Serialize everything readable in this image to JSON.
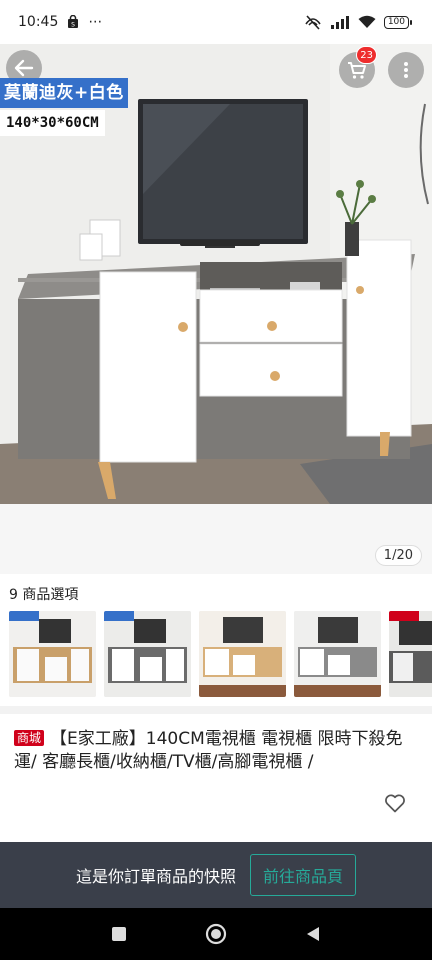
{
  "status_bar": {
    "time": "10:45",
    "more_indicator": "⋯",
    "battery": "100"
  },
  "product_image": {
    "color_tag": "莫蘭迪灰+白色",
    "size_tag": "140*30*60CM",
    "page_counter": "1/20",
    "cart_count": "23"
  },
  "variants": {
    "label": "9 商品選項",
    "thumbnails": [
      {
        "name": "variant-1",
        "colors": [
          "#c9a06a",
          "#f5f5f5"
        ]
      },
      {
        "name": "variant-2",
        "colors": [
          "#6b6b6b",
          "#ffffff"
        ]
      },
      {
        "name": "variant-3",
        "colors": [
          "#d8b07a",
          "#ffffff"
        ]
      },
      {
        "name": "variant-4",
        "colors": [
          "#8a8a8a",
          "#ffffff"
        ]
      },
      {
        "name": "variant-5",
        "colors": [
          "#5b5b5b",
          "#f0f0f0"
        ]
      }
    ]
  },
  "product": {
    "mall_badge": "商城",
    "title": "【E家工廠】140CM電視櫃 電視櫃 限時下殺免運/ 客廳長櫃/收納櫃/TV櫃/高腳電視櫃 /"
  },
  "snapshot_bar": {
    "text": "這是你訂單商品的快照",
    "button_label": "前往商品頁"
  },
  "colors": {
    "accent_teal": "#26aa99",
    "mall_red": "#d0011b",
    "tag_blue": "#3570c9",
    "bar_dark": "#3a3f4a"
  }
}
